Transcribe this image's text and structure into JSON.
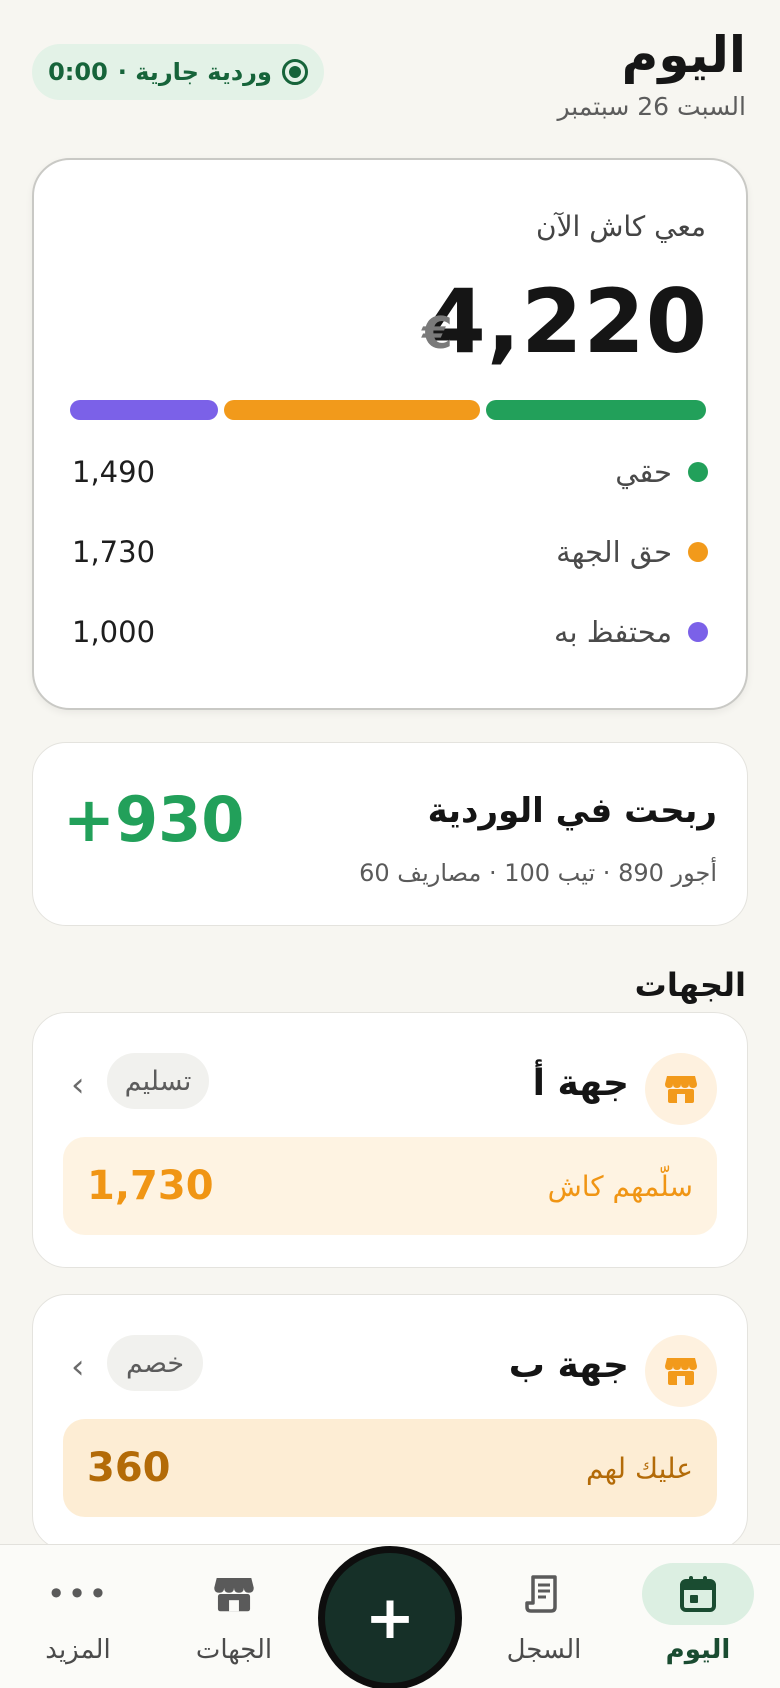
{
  "header": {
    "title": "اليوم",
    "date": "السبت 26 سبتمبر",
    "shift_status": "وردية جارية ·",
    "shift_timer": "0:00"
  },
  "cash_card": {
    "label": "معي كاش الآن",
    "amount": "4,220",
    "currency": "€",
    "breakdown": [
      {
        "label": "حقي",
        "value": "1,490",
        "color": "#22A05A"
      },
      {
        "label": "حق الجهة",
        "value": "1,730",
        "color": "#F29A1B"
      },
      {
        "label": "محتفظ به",
        "value": "1,000",
        "color": "#7B61E8"
      }
    ]
  },
  "profit_card": {
    "title": "ربحت في الوردية",
    "detail": "أجور 890 · تيب 100 · مصاريف 60",
    "amount": "+930"
  },
  "parties_section": {
    "title": "الجهات",
    "items": [
      {
        "name": "جهة أ",
        "tag": "تسليم",
        "box_label": "سلّمهم كاش",
        "box_amount": "1,730",
        "icon": "store-icon"
      },
      {
        "name": "جهة ب",
        "tag": "خصم",
        "box_label": "عليك لهم",
        "box_amount": "360",
        "icon": "store-icon"
      }
    ]
  },
  "bottom_nav": {
    "today": "اليوم",
    "log": "السجل",
    "add": "+",
    "parties": "الجهات",
    "more": "المزيد"
  }
}
